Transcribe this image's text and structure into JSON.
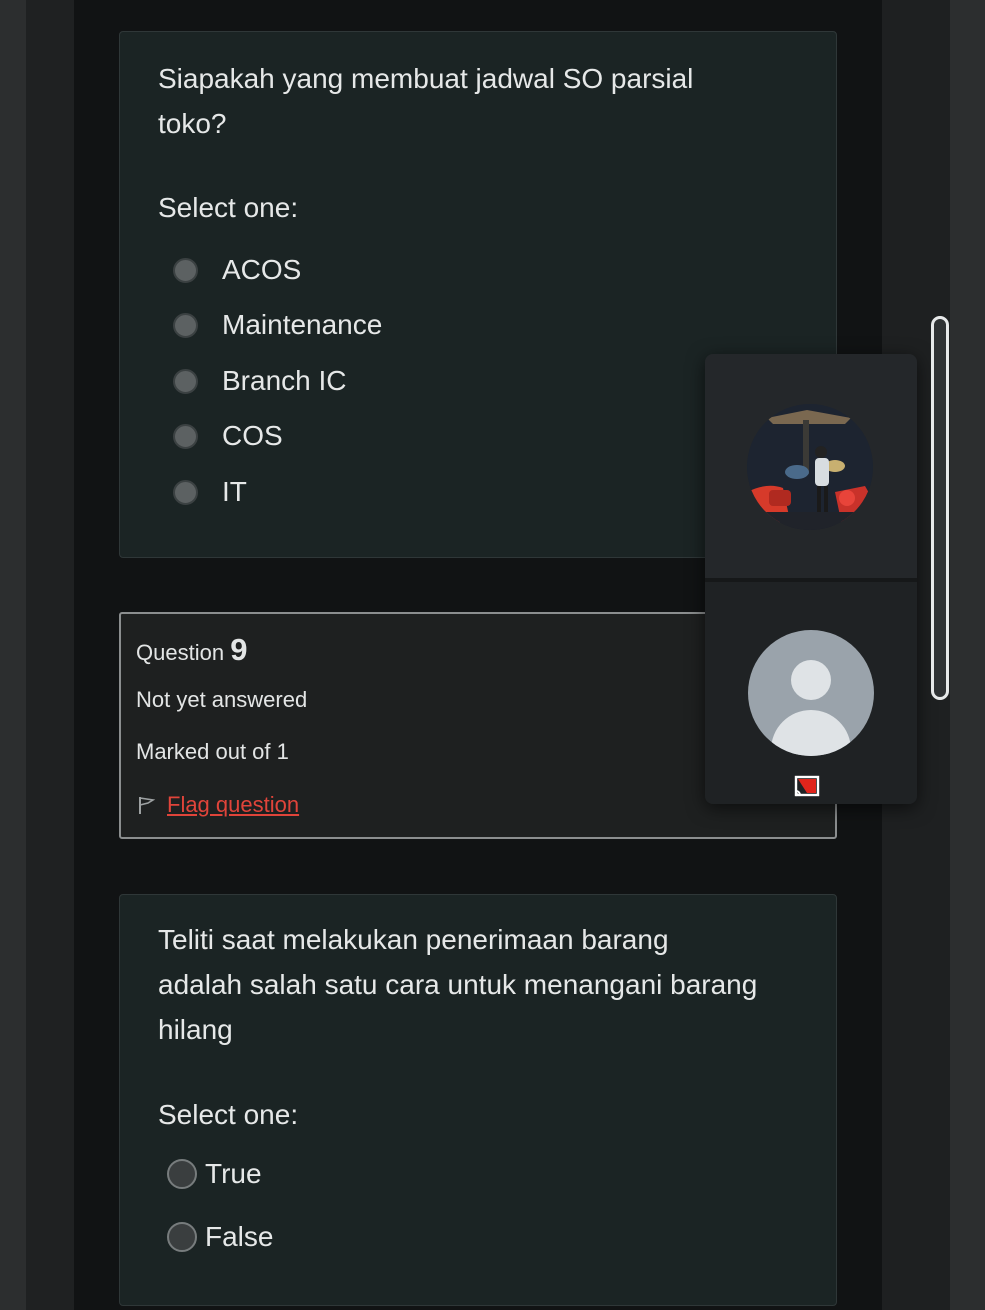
{
  "question8": {
    "text_line1": "Siapakah yang membuat jadwal SO parsial",
    "text_line2": "toko?",
    "select_label": "Select one:",
    "options": [
      "ACOS",
      "Maintenance",
      "Branch IC",
      "COS",
      "IT"
    ]
  },
  "question9": {
    "label": "Question",
    "number": "9",
    "status": "Not yet answered",
    "marks": "Marked out of 1",
    "flag_label": "Flag question",
    "text_line1": "Teliti saat melakukan penerimaan barang",
    "text_line2": "adalah salah satu cara untuk menangani barang",
    "text_line3": "hilang",
    "select_label": "Select one:",
    "options": [
      "True",
      "False"
    ]
  },
  "video_overlay": {
    "participants": [
      "profile-photo",
      "default-avatar"
    ],
    "cast_icon": "cast-icon"
  },
  "colors": {
    "background": "#111314",
    "card": "#1b2424",
    "text": "#e6e8e8",
    "link": "#e0443a"
  }
}
